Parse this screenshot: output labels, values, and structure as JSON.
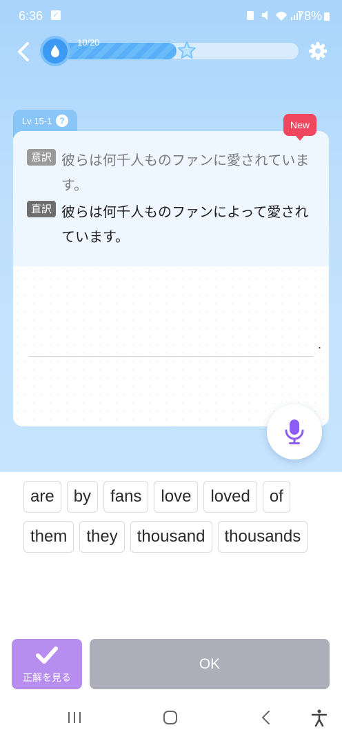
{
  "status_bar": {
    "time": "6:36",
    "battery": "78%"
  },
  "header": {
    "progress_text": "10/20",
    "progress_fraction": 0.5
  },
  "card": {
    "level_label": "Lv 15-1",
    "help_label": "?",
    "new_badge": "New",
    "free_translation_tag": "意訳",
    "free_translation": "彼らは何千人ものファンに愛されています。",
    "literal_translation_tag": "直訳",
    "literal_translation": "彼らは何千人ものファンによって愛されています。",
    "answer_suffix": "."
  },
  "word_bank": {
    "words": [
      "are",
      "by",
      "fans",
      "love",
      "loved",
      "of",
      "them",
      "they",
      "thousand",
      "thousands"
    ]
  },
  "actions": {
    "show_answer_label": "正解を見る",
    "ok_label": "OK"
  },
  "colors": {
    "background_top": "#a9d4fb",
    "progress": "#5ab0f8",
    "new_badge": "#f0465e",
    "show_answer": "#b78df0",
    "ok_disabled": "#aeadba",
    "mic": "#8b5cf6"
  }
}
